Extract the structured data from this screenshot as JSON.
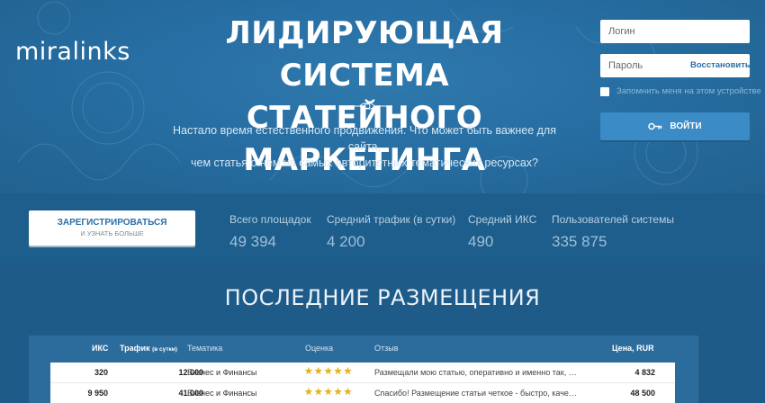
{
  "brand": {
    "logo": "miralinks"
  },
  "hero": {
    "title_line1": "ЛИДИРУЮЩАЯ СИСТЕМА",
    "title_line2": "СТАТЕЙНОГО МАРКЕТИНГА",
    "subtitle_line1": "Настало время естественного продвижения. Что может быть важнее для сайта,",
    "subtitle_line2": "чем статья о нём на самых авторитетных тематических ресурсах?"
  },
  "login": {
    "login_placeholder": "Логин",
    "password_placeholder": "Пароль",
    "restore_label": "Восстановить",
    "remember_label": "Запомнить меня на этом устройстве",
    "submit_label": "ВОЙТИ"
  },
  "register": {
    "main_label": "ЗАРЕГИСТРИРОВАТЬСЯ",
    "sub_label": "И УЗНАТЬ БОЛЬШЕ"
  },
  "stats": [
    {
      "label": "Всего площадок",
      "value": "49 394"
    },
    {
      "label": "Средний трафик (в сутки)",
      "value": "4 200"
    },
    {
      "label": "Средний ИКС",
      "value": "490"
    },
    {
      "label": "Пользователей системы",
      "value": "335 875"
    }
  ],
  "placements": {
    "title": "ПОСЛЕДНИЕ РАЗМЕЩЕНИЯ",
    "columns": {
      "iks": "ИКС",
      "traffic": "Трафик",
      "traffic_note": "(в сутки)",
      "topic": "Тематика",
      "rating": "Оценка",
      "review": "Отзыв",
      "price": "Цена, RUR"
    },
    "rows": [
      {
        "iks": "320",
        "traffic": "12 000",
        "topic": "Бизнес и Финансы",
        "stars": 5,
        "review": "Размещали мою статью, оперативно и именно так, как я ее...",
        "price": "4 832"
      },
      {
        "iks": "9 950",
        "traffic": "41 000",
        "topic": "Бизнес и Финансы",
        "stars": 5,
        "review": "Спасибо! Размещение статьи четкое - быстро, качественно...",
        "price": "48 500"
      }
    ]
  },
  "colors": {
    "hero_bg": "#276ea3",
    "band_bg": "#1e5e8c",
    "accent_button": "#3a8bc6",
    "link": "#2a6fa6",
    "star": "#e8b417"
  }
}
